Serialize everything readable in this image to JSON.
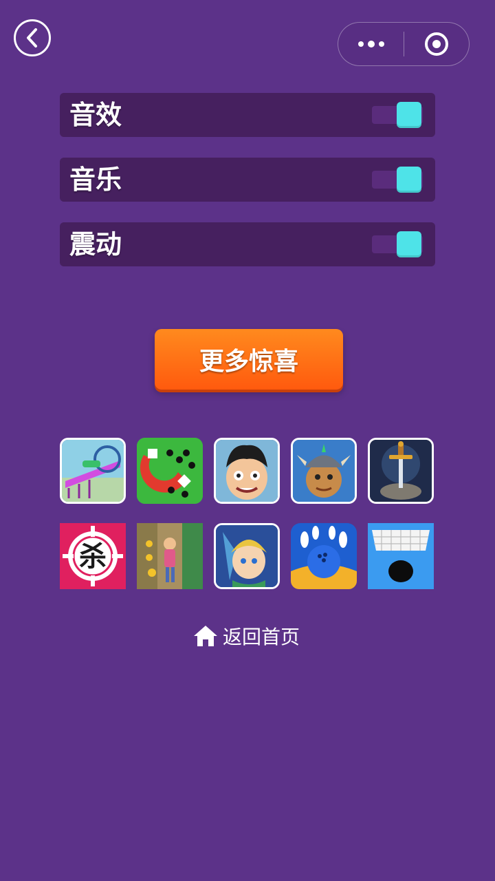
{
  "nav": {
    "back_icon": "chevron-left-icon",
    "more_icon": "more-dots-icon",
    "close_icon": "target-close-icon"
  },
  "settings": [
    {
      "label": "音效",
      "enabled": true
    },
    {
      "label": "音乐",
      "enabled": true
    },
    {
      "label": "震动",
      "enabled": true
    }
  ],
  "more_button": {
    "label": "更多惊喜"
  },
  "games": [
    {
      "name": "stunt-car-ramp",
      "icon": "car-ramp-icon"
    },
    {
      "name": "magnet-balls",
      "icon": "magnet-icon"
    },
    {
      "name": "boy-character",
      "icon": "character-icon"
    },
    {
      "name": "viking-warrior",
      "icon": "warrior-icon"
    },
    {
      "name": "sword-in-stone",
      "icon": "sword-icon"
    },
    {
      "name": "kill-target",
      "icon": "crosshair-icon",
      "text": "杀"
    },
    {
      "name": "subway-runner",
      "icon": "runner-icon"
    },
    {
      "name": "elf-hero",
      "icon": "elf-icon"
    },
    {
      "name": "bowling-ball",
      "icon": "bowling-icon"
    },
    {
      "name": "hole-blocks",
      "icon": "hole-icon"
    }
  ],
  "home_link": {
    "label": "返回首页",
    "icon": "home-icon"
  },
  "colors": {
    "background": "#5c3289",
    "row": "#46205f",
    "toggle_on": "#4ee3e8",
    "button": "#ff6a14"
  }
}
